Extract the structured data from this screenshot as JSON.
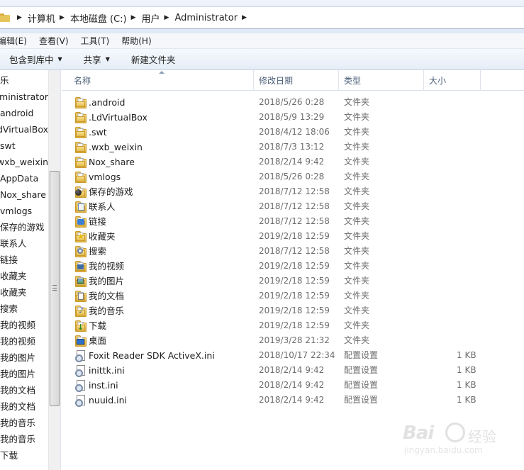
{
  "address_bar": {
    "crumbs": [
      "计算机",
      "本地磁盘 (C:)",
      "用户",
      "Administrator"
    ]
  },
  "menu": [
    "编辑(E)",
    "查看(V)",
    "工具(T)",
    "帮助(H)"
  ],
  "toolbar": {
    "include_library": "包含到库中",
    "share": "共享",
    "new_folder": "新建文件夹"
  },
  "nav_pane": {
    "items": [
      "乐",
      "Administrator",
      "android",
      "LdVirtualBox",
      "swt",
      "wxb_weixin",
      "AppData",
      "Nox_share",
      "vmlogs",
      "保存的游戏",
      "联系人",
      "链接",
      "收藏夹",
      "收藏夹",
      "搜索",
      "我的视频",
      "我的视频",
      "我的图片",
      "我的图片",
      "我的文档",
      "我的文档",
      "我的音乐",
      "我的音乐",
      "下载"
    ]
  },
  "columns": {
    "name": "名称",
    "date": "修改日期",
    "type": "类型",
    "size": "大小"
  },
  "files": [
    {
      "name": ".android",
      "date": "2018/5/26 0:28",
      "type": "文件夹",
      "size": "",
      "icon": "folder-icon"
    },
    {
      "name": ".LdVirtualBox",
      "date": "2018/5/9 13:29",
      "type": "文件夹",
      "size": "",
      "icon": "folder-icon"
    },
    {
      "name": ".swt",
      "date": "2018/4/12 18:06",
      "type": "文件夹",
      "size": "",
      "icon": "folder-icon"
    },
    {
      "name": ".wxb_weixin",
      "date": "2018/7/3 13:12",
      "type": "文件夹",
      "size": "",
      "icon": "folder-icon"
    },
    {
      "name": "Nox_share",
      "date": "2018/2/14 9:42",
      "type": "文件夹",
      "size": "",
      "icon": "folder-icon"
    },
    {
      "name": "vmlogs",
      "date": "2018/5/26 0:28",
      "type": "文件夹",
      "size": "",
      "icon": "folder-icon"
    },
    {
      "name": "保存的游戏",
      "date": "2018/7/12 12:58",
      "type": "文件夹",
      "size": "",
      "icon": "saved-games-icon"
    },
    {
      "name": "联系人",
      "date": "2018/7/12 12:58",
      "type": "文件夹",
      "size": "",
      "icon": "contacts-icon"
    },
    {
      "name": "链接",
      "date": "2018/7/12 12:58",
      "type": "文件夹",
      "size": "",
      "icon": "links-icon"
    },
    {
      "name": "收藏夹",
      "date": "2019/2/18 12:59",
      "type": "文件夹",
      "size": "",
      "icon": "favorites-icon"
    },
    {
      "name": "搜索",
      "date": "2018/7/12 12:58",
      "type": "文件夹",
      "size": "",
      "icon": "searches-icon"
    },
    {
      "name": "我的视频",
      "date": "2019/2/18 12:59",
      "type": "文件夹",
      "size": "",
      "icon": "videos-icon"
    },
    {
      "name": "我的图片",
      "date": "2019/2/18 12:59",
      "type": "文件夹",
      "size": "",
      "icon": "pictures-icon"
    },
    {
      "name": "我的文档",
      "date": "2019/2/18 12:59",
      "type": "文件夹",
      "size": "",
      "icon": "documents-icon"
    },
    {
      "name": "我的音乐",
      "date": "2019/2/18 12:59",
      "type": "文件夹",
      "size": "",
      "icon": "music-icon"
    },
    {
      "name": "下载",
      "date": "2019/2/18 12:59",
      "type": "文件夹",
      "size": "",
      "icon": "downloads-icon"
    },
    {
      "name": "桌面",
      "date": "2019/3/28 21:32",
      "type": "文件夹",
      "size": "",
      "icon": "desktop-icon"
    },
    {
      "name": "Foxit Reader SDK ActiveX.ini",
      "date": "2018/10/17 22:34",
      "type": "配置设置",
      "size": "1 KB",
      "icon": "ini-file-icon"
    },
    {
      "name": "inittk.ini",
      "date": "2018/2/14 9:42",
      "type": "配置设置",
      "size": "1 KB",
      "icon": "ini-file-icon"
    },
    {
      "name": "inst.ini",
      "date": "2018/2/14 9:42",
      "type": "配置设置",
      "size": "1 KB",
      "icon": "ini-file-icon"
    },
    {
      "name": "nuuid.ini",
      "date": "2018/2/14 9:42",
      "type": "配置设置",
      "size": "1 KB",
      "icon": "ini-file-icon"
    }
  ],
  "watermark": {
    "brand": "Bai",
    "brand2": "经验",
    "url": "jingyan.baidu.com"
  }
}
